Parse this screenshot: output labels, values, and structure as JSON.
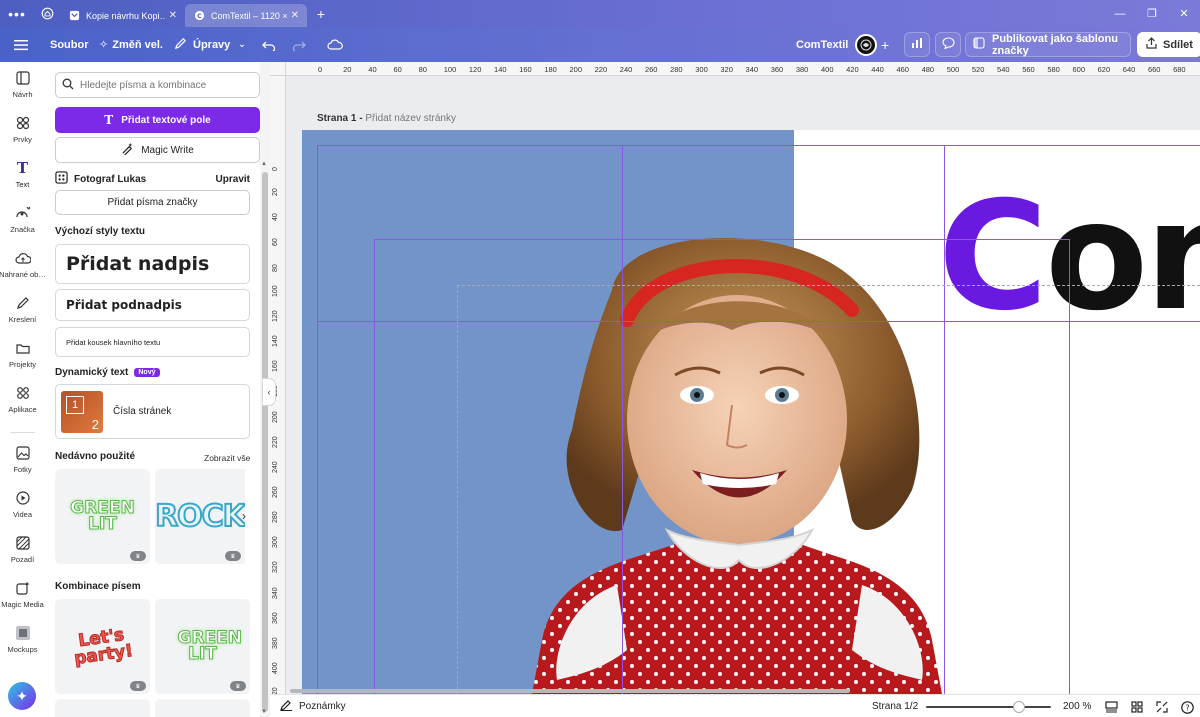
{
  "browser": {
    "tabs": [
      {
        "label": "Kopie návrhu Kopi…",
        "active": false
      },
      {
        "label": "ComTextil – 1120 × …",
        "active": true
      }
    ]
  },
  "toolbar": {
    "file": "Soubor",
    "resize": "Změň vel.",
    "edit": "Úpravy",
    "doc_title": "ComTextil",
    "publish": "Publikovat jako šablonu značky",
    "share": "Sdílet"
  },
  "rail": [
    {
      "label": "Návrh",
      "icon": "layout-icon"
    },
    {
      "label": "Prvky",
      "icon": "elements-icon"
    },
    {
      "label": "Text",
      "icon": "text-icon",
      "active": true
    },
    {
      "label": "Značka",
      "icon": "brand-icon"
    },
    {
      "label": "Nahrané ob…",
      "icon": "upload-icon"
    },
    {
      "label": "Kreslení",
      "icon": "draw-icon"
    },
    {
      "label": "Projekty",
      "icon": "folder-icon"
    },
    {
      "label": "Aplikace",
      "icon": "apps-icon"
    },
    {
      "label": "Fotky",
      "icon": "photo-icon"
    },
    {
      "label": "Videa",
      "icon": "video-icon"
    },
    {
      "label": "Pozadí",
      "icon": "background-icon"
    },
    {
      "label": "Magic Media",
      "icon": "magic-media-icon"
    },
    {
      "label": "Mockups",
      "icon": "mockups-icon"
    }
  ],
  "panel": {
    "search_placeholder": "Hledejte písma a kombinace",
    "add_textbox": "Přidat textové pole",
    "magic_write": "Magic Write",
    "brand_name": "Fotograf Lukas",
    "brand_edit": "Upravit",
    "add_brand_fonts": "Přidat písma značky",
    "default_styles_title": "Výchozí styly textu",
    "add_heading": "Přidat nadpis",
    "add_subheading": "Přidat podnadpis",
    "add_body": "Přidat kousek hlavního textu",
    "dynamic_title": "Dynamický text",
    "dynamic_badge": "Nový",
    "page_numbers": "Čísla stránek",
    "page_numbers_thumb": [
      "1",
      "2"
    ],
    "recent_title": "Nedávno použité",
    "see_all": "Zobrazit vše",
    "recent_items": [
      "GREEN LIT",
      "ROCK"
    ],
    "combos_title": "Kombinace písem",
    "combo_items": [
      "Let's party!",
      "GREEN LIT"
    ]
  },
  "canvas": {
    "page_label": "Strana 1 -",
    "page_name_placeholder": "Přidat název stránky",
    "big_text_first": "C",
    "big_text_rest": "om",
    "ruler_top": [
      "0",
      "20",
      "40",
      "60",
      "80",
      "100",
      "120",
      "140",
      "160",
      "180",
      "200",
      "220",
      "240",
      "260",
      "280",
      "300",
      "320",
      "340",
      "360",
      "380",
      "400",
      "420",
      "440",
      "460",
      "480",
      "500",
      "520",
      "540",
      "560",
      "580",
      "600",
      "620",
      "640",
      "660",
      "680"
    ],
    "ruler_left": [
      "0",
      "20",
      "40",
      "60",
      "80",
      "100",
      "120",
      "140",
      "160",
      "180",
      "200",
      "220",
      "240",
      "260",
      "280",
      "300",
      "320",
      "340",
      "360",
      "380",
      "400",
      "420"
    ]
  },
  "bottombar": {
    "notes": "Poznámky",
    "page_indicator": "Strana 1/2",
    "zoom": "200 %",
    "zoom_slider_fraction": 0.74
  },
  "colors": {
    "accent": "#7d2ae8",
    "canvas_blue": "#7294c8",
    "guide": "#8b55e6"
  }
}
